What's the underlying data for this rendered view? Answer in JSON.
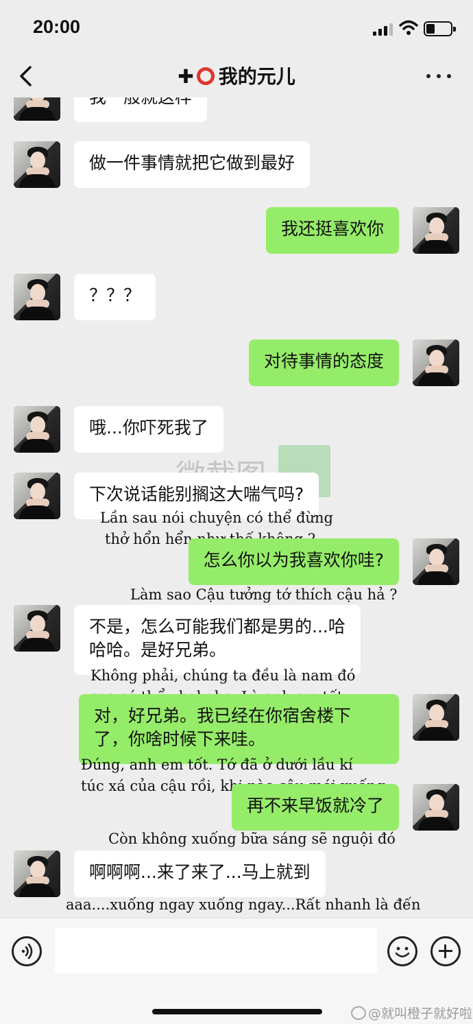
{
  "status_bar": {
    "time": "20:00"
  },
  "header": {
    "title": "我的元儿",
    "back_icon": "chevron-left-icon",
    "more_icon": "ellipsis-icon"
  },
  "messages": [
    {
      "side": "in",
      "text": "我一般就这样"
    },
    {
      "side": "in",
      "text": "做一件事情就把它做到最好"
    },
    {
      "side": "out",
      "text": "我还挺喜欢你"
    },
    {
      "side": "in",
      "text": "？？？"
    },
    {
      "side": "out",
      "text": "对待事情的态度"
    },
    {
      "side": "in",
      "text": "哦...你吓死我了"
    },
    {
      "side": "in",
      "text": "下次说话能别搁这大喘气吗?"
    },
    {
      "side": "out",
      "text": "怎么你以为我喜欢你哇?"
    },
    {
      "side": "in",
      "text": "不是，怎么可能我们都是男的...哈",
      "text2": "哈哈。是好兄弟。"
    },
    {
      "side": "out",
      "text": "对，好兄弟。我已经在你宿舍楼下",
      "text2": "了，你啥时候下来哇。"
    },
    {
      "side": "out",
      "text": "再不来早饭就冷了"
    },
    {
      "side": "in",
      "text": "啊啊啊...来了来了...马上就到"
    }
  ],
  "captions": [
    "Lần sau nói chuyện có thể đừng",
    "thở hổn hển như thế không ?",
    "Làm sao Cậu tưởng tớ thích cậu hả ?",
    "Không phải, chúng ta đều là nam đó",
    "sao có thể...hahaha. Là anh em tốt.",
    "Đúng, anh em tốt. Tớ đã ở dưới lầu kí",
    "túc xá của cậu rồi, khi nào cậu mới xuống",
    "Còn không xuống bữa sáng sẽ nguội đó",
    "aaa....xuống ngay xuống ngay...Rất nhanh là đến"
  ],
  "watermark": {
    "text": "微截图"
  },
  "input_bar": {
    "voice_icon": "voice-icon",
    "emoji_icon": "emoji-icon",
    "plus_icon": "plus-icon"
  },
  "credit": "@就叫橙子就好啦"
}
